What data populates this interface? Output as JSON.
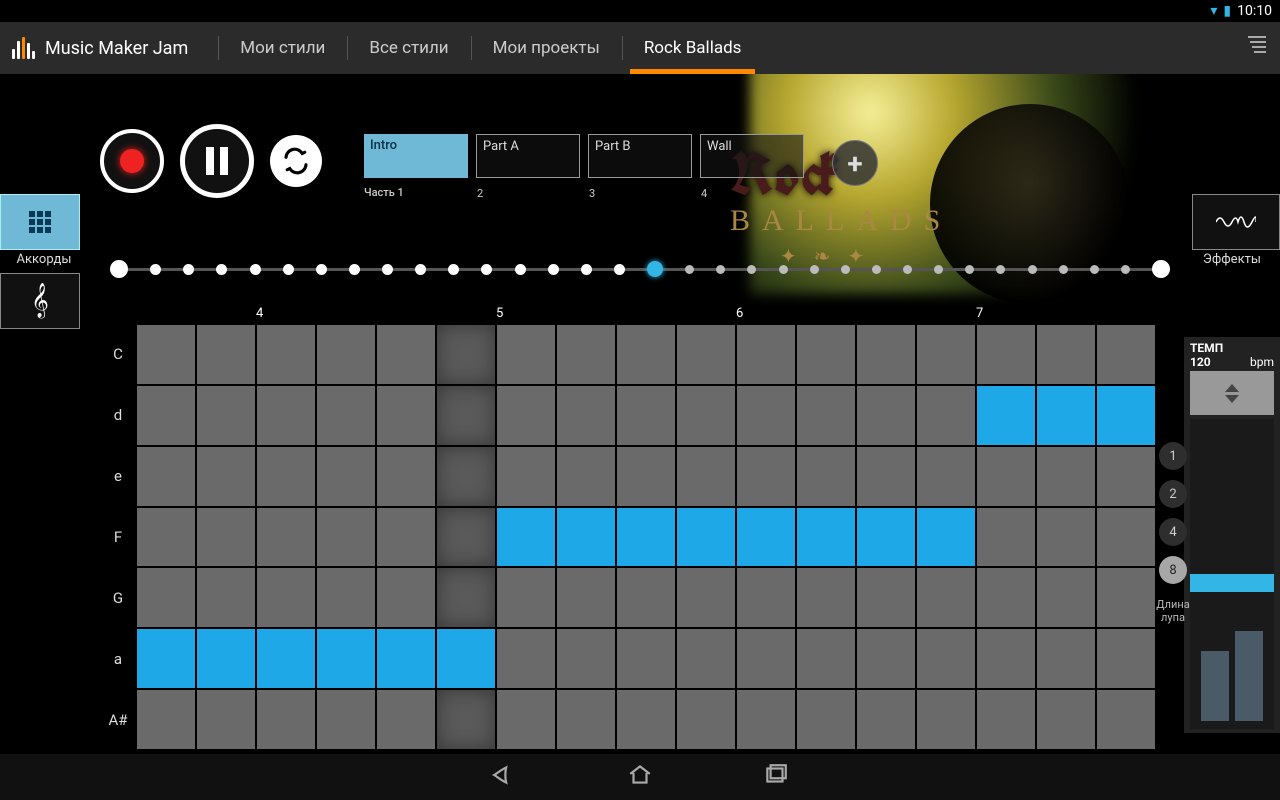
{
  "status": {
    "time": "10:10"
  },
  "app": {
    "title": "Music Maker Jam"
  },
  "tabs": {
    "myStyles": "Мои стили",
    "allStyles": "Все стили",
    "myProjects": "Мои проекты",
    "current": "Rock Ballads"
  },
  "hero": {
    "line1": "Rock",
    "line2": "BALLADS"
  },
  "leftSide": {
    "chords": "Аккорды"
  },
  "rightSide": {
    "effects": "Эффекты"
  },
  "parts": [
    {
      "name": "Intro",
      "sub": "Часть 1",
      "active": true
    },
    {
      "name": "Part A",
      "sub": "2",
      "active": false
    },
    {
      "name": "Part B",
      "sub": "3",
      "active": false
    },
    {
      "name": "Wall",
      "sub": "4",
      "active": false
    }
  ],
  "timeline": {
    "totalDots": 33,
    "bigDots": [
      0,
      32
    ],
    "filledUpTo": 16,
    "current": 16
  },
  "grid": {
    "rowLabels": [
      "C",
      "d",
      "e",
      "F",
      "G",
      "a",
      "A#"
    ],
    "cols": 17,
    "colMarkers": {
      "2": "4",
      "6": "5",
      "10": "6",
      "14": "7"
    },
    "playheadCol": 5,
    "activeCells": [
      [
        1,
        14
      ],
      [
        1,
        15
      ],
      [
        1,
        16
      ],
      [
        3,
        6
      ],
      [
        3,
        7
      ],
      [
        3,
        8
      ],
      [
        3,
        9
      ],
      [
        3,
        10
      ],
      [
        3,
        11
      ],
      [
        3,
        12
      ],
      [
        3,
        13
      ],
      [
        5,
        0
      ],
      [
        5,
        1
      ],
      [
        5,
        2
      ],
      [
        5,
        3
      ],
      [
        5,
        4
      ],
      [
        5,
        5
      ]
    ]
  },
  "loop": {
    "buttons": [
      "1",
      "2",
      "4",
      "8"
    ],
    "active": "8",
    "label": "Длина\nлупа"
  },
  "tempo": {
    "label": "ТЕМП",
    "value": "120",
    "unit": "bpm"
  }
}
